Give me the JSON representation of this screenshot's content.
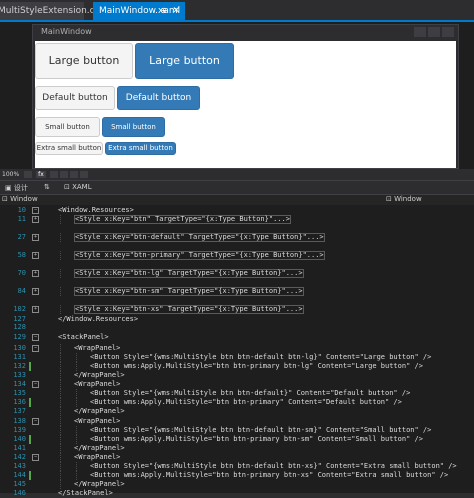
{
  "tabs": {
    "inactive": "MultiStyleExtension.cs",
    "active": "MainWindow.xaml",
    "pin_glyph": "⊕",
    "close_glyph": "✕"
  },
  "designer": {
    "window_title": "MainWindow",
    "large_default": "Large button",
    "large_primary": "Large button",
    "default_default": "Default button",
    "default_primary": "Default button",
    "small_default": "Small button",
    "small_primary": "Small button",
    "xs_default": "Extra small button",
    "xs_primary": "Extra small button"
  },
  "toolbar": {
    "zoom": "100%",
    "fx_label": "fx"
  },
  "view_tabs": {
    "design": "设计",
    "swap": "⇅",
    "xaml": "XAML"
  },
  "navbar": {
    "left": "Window",
    "right": "Window"
  },
  "code_lines": [
    {
      "n": "10",
      "text": "<Window.Resources>"
    },
    {
      "n": "11",
      "text": "<Style x:Key=\"btn\" TargetType=\"{x:Type Button}\"...>"
    },
    {
      "n": "27",
      "text": "<Style x:Key=\"btn-default\" TargetType=\"{x:Type Button}\"...>"
    },
    {
      "n": "58",
      "text": "<Style x:Key=\"btn-primary\" TargetType=\"{x:Type Button}\"...>"
    },
    {
      "n": "70",
      "text": "<Style x:Key=\"btn-lg\" TargetType=\"{x:Type Button}\"...>"
    },
    {
      "n": "84",
      "text": "<Style x:Key=\"btn-sm\" TargetType=\"{x:Type Button}\"...>"
    },
    {
      "n": "102",
      "text": "<Style x:Key=\"btn-xs\" TargetType=\"{x:Type Button}\"...>"
    },
    {
      "n": "127",
      "text": "</Window.Resources>"
    },
    {
      "n": "128",
      "text": ""
    },
    {
      "n": "129",
      "text": "<StackPanel>"
    },
    {
      "n": "130",
      "text": "<WrapPanel>"
    },
    {
      "n": "131",
      "text": "<Button Style=\"{wms:MultiStyle btn btn-default btn-lg}\" Content=\"Large button\" />"
    },
    {
      "n": "132",
      "text": "<Button wms:Apply.MultiStyle=\"btn btn-primary btn-lg\" Content=\"Large button\" />"
    },
    {
      "n": "133",
      "text": "</WrapPanel>"
    },
    {
      "n": "134",
      "text": "<WrapPanel>"
    },
    {
      "n": "135",
      "text": "<Button Style=\"{wms:MultiStyle btn btn-default}\" Content=\"Default button\" />"
    },
    {
      "n": "136",
      "text": "<Button wms:Apply.MultiStyle=\"btn btn-primary\" Content=\"Default button\" />"
    },
    {
      "n": "137",
      "text": "</WrapPanel>"
    },
    {
      "n": "138",
      "text": "<WrapPanel>"
    },
    {
      "n": "139",
      "text": "<Button Style=\"{wms:MultiStyle btn btn-default btn-sm}\" Content=\"Small button\" />"
    },
    {
      "n": "140",
      "text": "<Button wms:Apply.MultiStyle=\"btn btn-primary btn-sm\" Content=\"Small button\" />"
    },
    {
      "n": "141",
      "text": "</WrapPanel>"
    },
    {
      "n": "142",
      "text": "<WrapPanel>"
    },
    {
      "n": "143",
      "text": "<Button Style=\"{wms:MultiStyle btn btn-default btn-xs}\" Content=\"Extra small button\" />"
    },
    {
      "n": "144",
      "text": "<Button wms:Apply.MultiStyle=\"btn btn-primary btn-xs\" Content=\"Extra small button\" />"
    },
    {
      "n": "145",
      "text": "</WrapPanel>"
    },
    {
      "n": "146",
      "text": "</StackPanel>"
    }
  ],
  "colors": {
    "accent": "#007acc",
    "primary_button": "#337ab7",
    "editor_background": "#1e1e1e",
    "line_number": "#2b91af"
  }
}
